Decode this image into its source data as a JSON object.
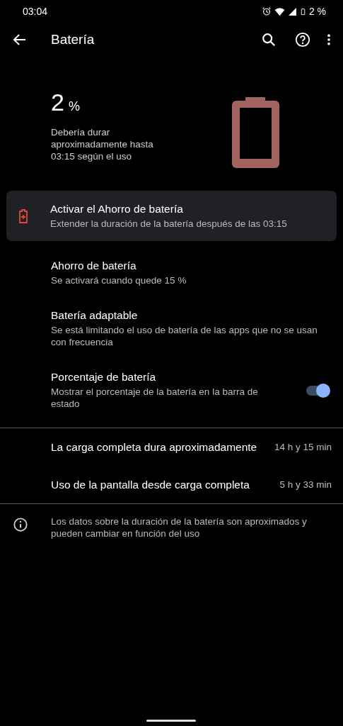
{
  "status_bar": {
    "time": "03:04",
    "battery_text": "2 %"
  },
  "app_bar": {
    "title": "Batería"
  },
  "header": {
    "level_text": "2",
    "unit": "%",
    "estimate": "Debería durar aproximadamente hasta 03:15 según el uso"
  },
  "suggestion": {
    "title": "Activar el Ahorro de batería",
    "subtitle": "Extender la duración de la batería después de las 03:15"
  },
  "settings": [
    {
      "kind": "plain",
      "title": "Ahorro de batería",
      "subtitle": "Se activará cuando quede 15 %"
    },
    {
      "kind": "plain",
      "title": "Batería adaptable",
      "subtitle": "Se está limitando el uso de batería de las apps que no se usan con frecuencia"
    },
    {
      "kind": "toggle",
      "title": "Porcentaje de batería",
      "subtitle": "Mostrar el porcentaje de la batería en la barra de estado",
      "on": true
    }
  ],
  "stats": [
    {
      "label": "La carga completa dura aproximadamente",
      "value": "14 h y 15 min"
    },
    {
      "label": "Uso de la pantalla desde carga completa",
      "value": "5 h y 33 min"
    }
  ],
  "note": {
    "text": "Los datos sobre la duración de la batería son aproximados y pueden cambiar en función del uso"
  }
}
